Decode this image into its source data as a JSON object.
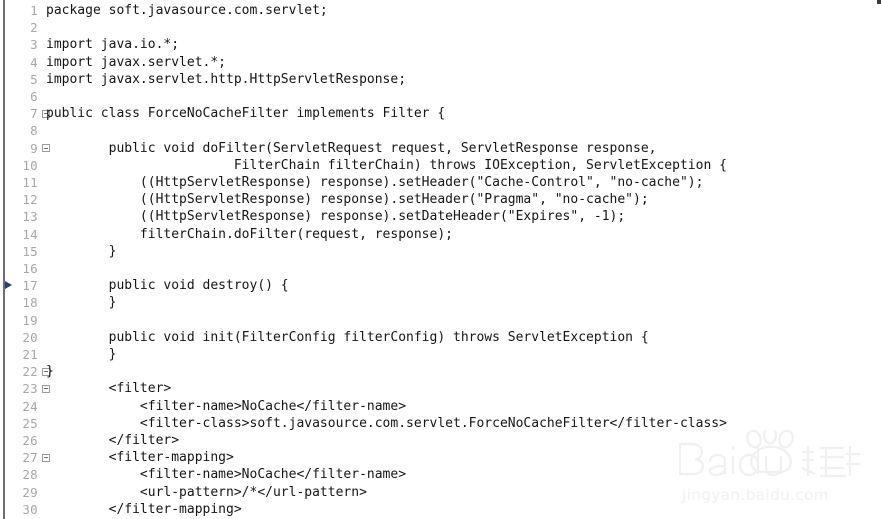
{
  "editor": {
    "language": "java",
    "background_color": "#ffffff",
    "text_color": "#151515",
    "line_number_color": "#a8a8a8",
    "marker_color": "#1f3f8f",
    "gutter_rule_color": "#6e6e6e",
    "total_lines": 30,
    "lines": [
      {
        "number": "1",
        "fold": false,
        "marker": false,
        "text": "package soft.javasource.com.servlet;"
      },
      {
        "number": "2",
        "fold": false,
        "marker": false,
        "text": ""
      },
      {
        "number": "3",
        "fold": false,
        "marker": false,
        "text": "import java.io.*;"
      },
      {
        "number": "4",
        "fold": false,
        "marker": false,
        "text": "import javax.servlet.*;"
      },
      {
        "number": "5",
        "fold": false,
        "marker": false,
        "text": "import javax.servlet.http.HttpServletResponse;"
      },
      {
        "number": "6",
        "fold": false,
        "marker": false,
        "text": ""
      },
      {
        "number": "7",
        "fold": true,
        "marker": false,
        "text": "public class ForceNoCacheFilter implements Filter {"
      },
      {
        "number": "8",
        "fold": false,
        "marker": false,
        "text": ""
      },
      {
        "number": "9",
        "fold": true,
        "marker": false,
        "text": "        public void doFilter(ServletRequest request, ServletResponse response,"
      },
      {
        "number": "10",
        "fold": false,
        "marker": false,
        "text": "                        FilterChain filterChain) throws IOException, ServletException {"
      },
      {
        "number": "11",
        "fold": false,
        "marker": false,
        "text": "            ((HttpServletResponse) response).setHeader(\"Cache-Control\", \"no-cache\");"
      },
      {
        "number": "12",
        "fold": false,
        "marker": false,
        "text": "            ((HttpServletResponse) response).setHeader(\"Pragma\", \"no-cache\");"
      },
      {
        "number": "13",
        "fold": false,
        "marker": false,
        "text": "            ((HttpServletResponse) response).setDateHeader(\"Expires\", -1);"
      },
      {
        "number": "14",
        "fold": false,
        "marker": false,
        "text": "            filterChain.doFilter(request, response);"
      },
      {
        "number": "15",
        "fold": false,
        "marker": false,
        "text": "        }"
      },
      {
        "number": "16",
        "fold": false,
        "marker": false,
        "text": ""
      },
      {
        "number": "17",
        "fold": false,
        "marker": true,
        "text": "        public void destroy() {"
      },
      {
        "number": "18",
        "fold": false,
        "marker": false,
        "text": "        }"
      },
      {
        "number": "19",
        "fold": false,
        "marker": false,
        "text": ""
      },
      {
        "number": "20",
        "fold": false,
        "marker": false,
        "text": "        public void init(FilterConfig filterConfig) throws ServletException {"
      },
      {
        "number": "21",
        "fold": false,
        "marker": false,
        "text": "        }"
      },
      {
        "number": "22",
        "fold": true,
        "marker": false,
        "text": "}"
      },
      {
        "number": "23",
        "fold": true,
        "marker": false,
        "text": "        <filter>"
      },
      {
        "number": "24",
        "fold": false,
        "marker": false,
        "text": "            <filter-name>NoCache</filter-name>"
      },
      {
        "number": "25",
        "fold": false,
        "marker": false,
        "text": "            <filter-class>soft.javasource.com.servlet.ForceNoCacheFilter</filter-class>"
      },
      {
        "number": "26",
        "fold": false,
        "marker": false,
        "text": "        </filter>"
      },
      {
        "number": "27",
        "fold": true,
        "marker": false,
        "text": "        <filter-mapping>"
      },
      {
        "number": "28",
        "fold": false,
        "marker": false,
        "text": "            <filter-name>NoCache</filter-name>"
      },
      {
        "number": "29",
        "fold": false,
        "marker": false,
        "text": "            <url-pattern>/*</url-pattern>"
      },
      {
        "number": "30",
        "fold": false,
        "marker": false,
        "text": "        </filter-mapping>"
      }
    ]
  },
  "watermark": {
    "brand": "Baidu",
    "brand_cn": "经验",
    "url": "jingyan.baidu.com",
    "color": "#f1f1f1"
  }
}
